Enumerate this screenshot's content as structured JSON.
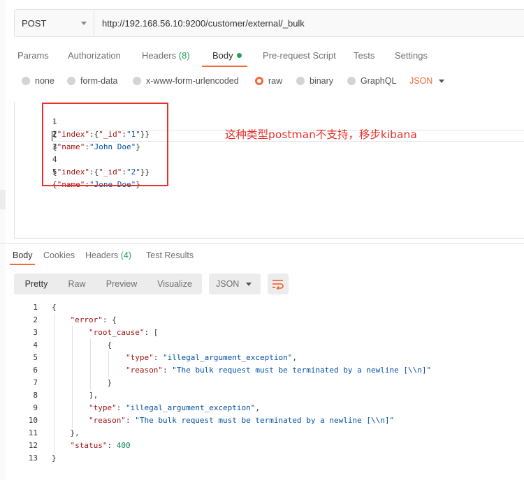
{
  "request": {
    "method": "POST",
    "url": "http://192.168.56.10:9200/customer/external/_bulk"
  },
  "request_tabs": [
    {
      "label": "Params"
    },
    {
      "label": "Authorization"
    },
    {
      "label": "Headers",
      "count": "(8)"
    },
    {
      "label": "Body"
    },
    {
      "label": "Pre-request Script"
    },
    {
      "label": "Tests"
    },
    {
      "label": "Settings"
    }
  ],
  "body_types": [
    "none",
    "form-data",
    "x-www-form-urlencoded",
    "raw",
    "binary",
    "GraphQL"
  ],
  "body_format": "JSON",
  "request_body": [
    {
      "num": "1",
      "text": "{\"index\":{\"_id\":\"1\"}}"
    },
    {
      "num": "2",
      "text": "{\"name\":\"John Doe\"}"
    },
    {
      "num": "3",
      "text": ""
    },
    {
      "num": "4",
      "text": "{\"index\":{\"_id\":\"2\"}}"
    },
    {
      "num": "5",
      "text": "{\"name\":\"Jone Doe\"}"
    }
  ],
  "annotation": "这种类型postman不支持，移步kibana",
  "response_tabs": [
    {
      "label": "Body"
    },
    {
      "label": "Cookies"
    },
    {
      "label": "Headers",
      "count": "(4)"
    },
    {
      "label": "Test Results"
    }
  ],
  "view_modes": [
    "Pretty",
    "Raw",
    "Preview",
    "Visualize"
  ],
  "response_format": "JSON",
  "response_body": [
    {
      "num": "1",
      "text": "{"
    },
    {
      "num": "2",
      "text": "    \"error\": {"
    },
    {
      "num": "3",
      "text": "        \"root_cause\": ["
    },
    {
      "num": "4",
      "text": "            {"
    },
    {
      "num": "5",
      "text": "                \"type\": \"illegal_argument_exception\","
    },
    {
      "num": "6",
      "text": "                \"reason\": \"The bulk request must be terminated by a newline [\\\\n]\""
    },
    {
      "num": "7",
      "text": "            }"
    },
    {
      "num": "8",
      "text": "        ],"
    },
    {
      "num": "9",
      "text": "        \"type\": \"illegal_argument_exception\","
    },
    {
      "num": "10",
      "text": "        \"reason\": \"The bulk request must be terminated by a newline [\\\\n]\""
    },
    {
      "num": "11",
      "text": "    },"
    },
    {
      "num": "12",
      "text": "    \"status\": 400"
    },
    {
      "num": "13",
      "text": "}"
    }
  ],
  "colors": {
    "accent": "#f26b3a",
    "success": "#25a25a",
    "annotation": "#e5322d"
  }
}
